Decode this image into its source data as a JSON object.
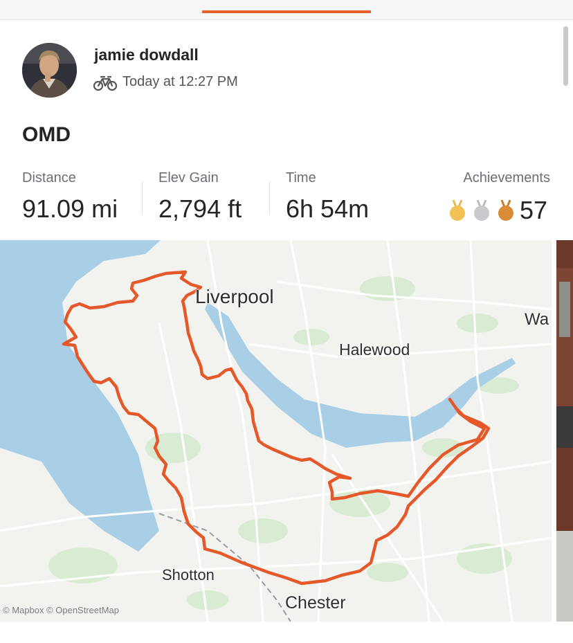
{
  "app": {
    "accent_color": "#e8632b"
  },
  "activity": {
    "athlete_name": "jamie dowdall",
    "activity_type_icon": "bike-icon",
    "timestamp": "Today at 12:27 PM",
    "title": "OMD"
  },
  "stats": {
    "distance": {
      "label": "Distance",
      "value": "91.09 mi"
    },
    "elev_gain": {
      "label": "Elev Gain",
      "value": "2,794 ft"
    },
    "time": {
      "label": "Time",
      "value": "6h 54m"
    },
    "achievements": {
      "label": "Achievements",
      "medals": [
        "gold-medal-icon",
        "silver-medal-icon",
        "bronze-medal-icon"
      ],
      "count": "57"
    }
  },
  "map": {
    "route_color": "#e8632b",
    "place_labels": {
      "liverpool": "Liverpool",
      "halewood": "Halewood",
      "wa": "Wa",
      "shotton": "Shotton",
      "chester": "Chester"
    },
    "attribution": "© Mapbox © OpenStreetMap"
  }
}
